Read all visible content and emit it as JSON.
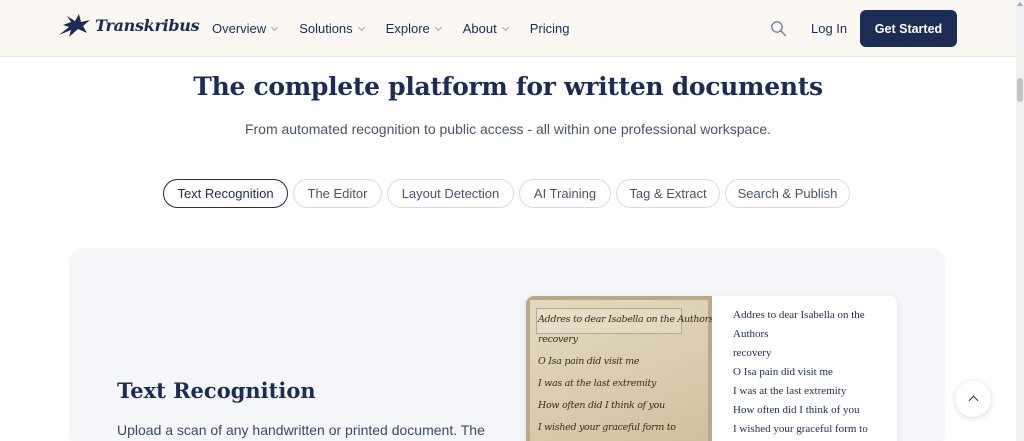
{
  "brand": {
    "name": "Transkribus"
  },
  "nav": {
    "items": [
      {
        "label": "Overview",
        "has_dropdown": true
      },
      {
        "label": "Solutions",
        "has_dropdown": true
      },
      {
        "label": "Explore",
        "has_dropdown": true
      },
      {
        "label": "About",
        "has_dropdown": true
      },
      {
        "label": "Pricing",
        "has_dropdown": false
      }
    ],
    "search_icon": "search-icon",
    "login_label": "Log In",
    "cta_label": "Get Started"
  },
  "hero": {
    "title": "The complete platform for written documents",
    "subtitle": "From automated recognition to public access - all within one professional workspace."
  },
  "tabs": [
    {
      "label": "Text Recognition",
      "active": true
    },
    {
      "label": "The Editor",
      "active": false
    },
    {
      "label": "Layout Detection",
      "active": false
    },
    {
      "label": "AI Training",
      "active": false
    },
    {
      "label": "Tag & Extract",
      "active": false
    },
    {
      "label": "Search & Publish",
      "active": false
    }
  ],
  "feature": {
    "title": "Text Recognition",
    "description": "Upload a scan of any handwritten or printed document. The",
    "scan_lines": [
      "Addres to dear Isabella on the Authors",
      "recovery",
      "O Isa pain did visit me",
      "I was at the last extremity",
      "How often did I think of you",
      "I wished your graceful form to"
    ],
    "transcription": [
      "Addres to dear Isabella on the",
      "Authors",
      "recovery",
      "O Isa pain did visit me",
      "I was at the last extremity",
      "How often did I think of you",
      "I wished your graceful form to"
    ]
  },
  "colors": {
    "primary": "#1c2c52",
    "nav_bg": "#fbf8f3",
    "panel_bg": "#f4f6f9"
  },
  "back_to_top_icon": "chevron-up-icon"
}
